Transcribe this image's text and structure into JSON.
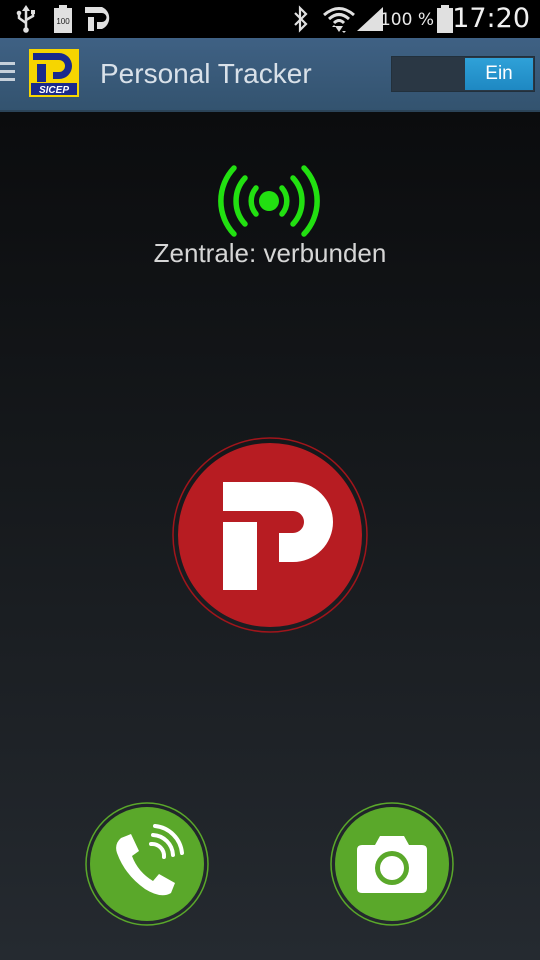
{
  "status_bar": {
    "icons": [
      "usb-icon",
      "battery-100-icon",
      "sicep-notification-icon",
      "bluetooth-icon",
      "wifi-icon",
      "signal-icon",
      "battery-icon"
    ],
    "battery_small_label": "100",
    "battery_percent": "100 %",
    "time": "17:20"
  },
  "action_bar": {
    "title": "Personal Tracker",
    "logo_text": "SICEP",
    "toggle_label": "Ein"
  },
  "main": {
    "connection_status": "Zentrale: verbunden"
  },
  "colors": {
    "action_bar": "#3f6184",
    "toggle_on": "#2fa1d8",
    "signal_green": "#22e011",
    "panic_red": "#b71c22",
    "button_green": "#5aa82a"
  }
}
